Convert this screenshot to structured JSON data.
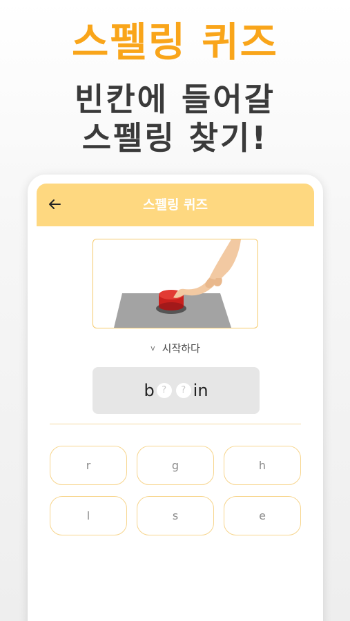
{
  "promo": {
    "title": "스펠링 퀴즈",
    "subtitle_line1": "빈칸에 들어갈",
    "subtitle_line2": "스펠링 찾기!"
  },
  "app": {
    "title": "스펠링 퀴즈",
    "back_icon": "arrow-left-icon",
    "accent_color": "#fed880",
    "promo_color": "#f9a51a"
  },
  "question": {
    "hint_icon": "chevron-down-icon",
    "meaning": "시작하다",
    "word_prefix": "b",
    "blank1": "?",
    "blank2": "?",
    "word_suffix": "in"
  },
  "choices": [
    "r",
    "g",
    "h",
    "l",
    "s",
    "e"
  ]
}
